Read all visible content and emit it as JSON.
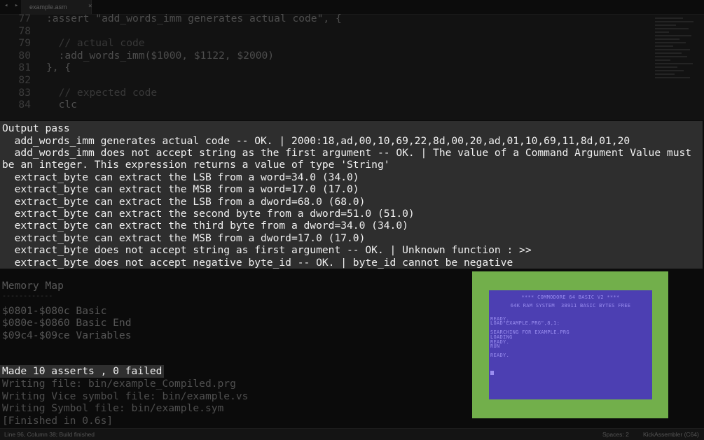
{
  "editor": {
    "tab_title": "example.asm",
    "lines": [
      {
        "num": "77",
        "text": ":assert \"add_words_imm generates actual code\", {"
      },
      {
        "num": "78",
        "text": ""
      },
      {
        "num": "79",
        "text": "  // actual code"
      },
      {
        "num": "80",
        "text": "  :add_words_imm($1000, $1122, $2000)"
      },
      {
        "num": "81",
        "text": "}, {"
      },
      {
        "num": "82",
        "text": ""
      },
      {
        "num": "83",
        "text": "  // expected code"
      },
      {
        "num": "84",
        "text": "  clc"
      }
    ]
  },
  "output": {
    "header": "Output pass",
    "lines": [
      "  add_words_imm generates actual code -- OK. | 2000:18,ad,00,10,69,22,8d,00,20,ad,01,10,69,11,8d,01,20",
      "  add_words_imm does not accept string as the first argument -- OK. | The value of a Command Argument Value must",
      "be an integer. This expression returns a value of type 'String'",
      "  extract_byte can extract the LSB from a word=34.0 (34.0)",
      "  extract_byte can extract the MSB from a word=17.0 (17.0)",
      "  extract_byte can extract the LSB from a dword=68.0 (68.0)",
      "  extract_byte can extract the second byte from a dword=51.0 (51.0)",
      "  extract_byte can extract the third byte from a dword=34.0 (34.0)",
      "  extract_byte can extract the MSB from a dword=17.0 (17.0)",
      "  extract_byte does not accept string as first argument -- OK. | Unknown function : >>",
      "  extract_byte does not accept negative byte_id -- OK. | byte_id cannot be negative"
    ]
  },
  "memory_map": {
    "title": "Memory Map",
    "rule": "------------",
    "items": [
      "$0801-$080c Basic",
      "$080e-$0860 Basic End",
      "$09c4-$09ce Variables"
    ]
  },
  "summary": "Made 10 asserts , 0 failed",
  "writes": [
    "Writing file: bin/example_Compiled.prg",
    "Writing Vice symbol file: bin/example.vs",
    "Writing Symbol file: bin/example.sym",
    "[Finished in 0.6s]"
  ],
  "status": {
    "position": "Line 96, Column 38; Build finished",
    "spaces": "Spaces: 2",
    "syntax": "KickAssembler (C64)"
  },
  "emulator": {
    "banner": "**** COMMODORE 64 BASIC V2 ****",
    "sysinfo": "64K RAM SYSTEM  38911 BASIC BYTES FREE",
    "lines": [
      "",
      "READY.",
      "LOAD\"EXAMPLE.PRG\",8,1:",
      "",
      "SEARCHING FOR EXAMPLE.PRG",
      "LOADING",
      "READY.",
      "RUN",
      "",
      "READY."
    ],
    "border_color": "#72af4b",
    "screen_color": "#4c3fb2",
    "text_color": "#9a8ef0"
  }
}
